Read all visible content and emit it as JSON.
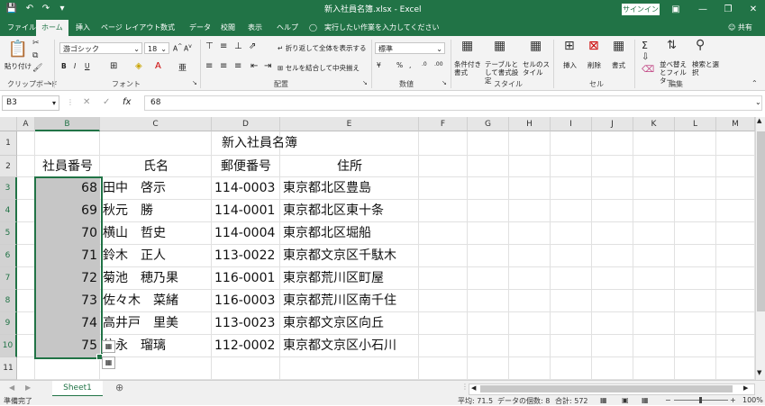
{
  "title_bar": {
    "document_title": "新入社員名簿.xlsx - Excel",
    "signin_label": "サインイン",
    "save_icon": "save-icon",
    "undo_icon": "undo-icon",
    "redo_icon": "redo-icon"
  },
  "tabs": [
    {
      "label": "ファイル"
    },
    {
      "label": "ホーム"
    },
    {
      "label": "挿入"
    },
    {
      "label": "ページ レイアウト"
    },
    {
      "label": "数式"
    },
    {
      "label": "データ"
    },
    {
      "label": "校閲"
    },
    {
      "label": "表示"
    },
    {
      "label": "ヘルプ"
    }
  ],
  "tell_me": "実行したい作業を入力してください",
  "share": "共有",
  "ribbon": {
    "clipboard": {
      "paste": "貼り付け",
      "label": "クリップボード"
    },
    "font": {
      "name": "游ゴシック",
      "size": "18",
      "label": "フォント"
    },
    "alignment": {
      "wrap": "折り返して全体を表示する",
      "merge": "セルを結合して中央揃え",
      "label": "配置"
    },
    "number": {
      "format": "標準",
      "label": "数値"
    },
    "styles": {
      "cond": "条件付き書式",
      "table": "テーブルとして書式設定",
      "cell": "セルのスタイル",
      "label": "スタイル"
    },
    "cells": {
      "insert": "挿入",
      "delete": "削除",
      "format": "書式",
      "label": "セル"
    },
    "editing": {
      "sort": "並べ替えとフィルター",
      "find": "検索と選択",
      "label": "編集"
    }
  },
  "formula_bar": {
    "name_box": "B3",
    "fx": "fx",
    "value": "68"
  },
  "columns": [
    "A",
    "B",
    "C",
    "D",
    "E",
    "F",
    "G",
    "H",
    "I",
    "J",
    "K",
    "L",
    "M"
  ],
  "rows": [
    "1",
    "2",
    "3",
    "4",
    "5",
    "6",
    "7",
    "8",
    "9",
    "10",
    "11"
  ],
  "sheet": {
    "title": "新入社員名簿",
    "headers": [
      "社員番号",
      "氏名",
      "郵便番号",
      "住所"
    ],
    "records": [
      {
        "id": "68",
        "name": "田中　啓示",
        "zip": "114-0003",
        "addr": "東京都北区豊島"
      },
      {
        "id": "69",
        "name": "秋元　勝",
        "zip": "114-0001",
        "addr": "東京都北区東十条"
      },
      {
        "id": "70",
        "name": "横山　哲史",
        "zip": "114-0004",
        "addr": "東京都北区堀船"
      },
      {
        "id": "71",
        "name": "鈴木　正人",
        "zip": "113-0022",
        "addr": "東京都文京区千駄木"
      },
      {
        "id": "72",
        "name": "菊池　穂乃果",
        "zip": "116-0001",
        "addr": "東京都荒川区町屋"
      },
      {
        "id": "73",
        "name": "佐々木　菜緒",
        "zip": "116-0003",
        "addr": "東京都荒川区南千住"
      },
      {
        "id": "74",
        "name": "高井戸　里美",
        "zip": "113-0023",
        "addr": "東京都文京区向丘"
      },
      {
        "id": "75",
        "name": "信永　瑠璃",
        "zip": "112-0002",
        "addr": "東京都文京区小石川"
      }
    ]
  },
  "sheet_tab": "Sheet1",
  "status": {
    "ready": "準備完了",
    "average": "平均: 71.5",
    "count": "データの個数: 8",
    "sum": "合計: 572",
    "zoom": "100%"
  },
  "colors": {
    "accent": "#217346",
    "selection": "#c6c6c6"
  }
}
